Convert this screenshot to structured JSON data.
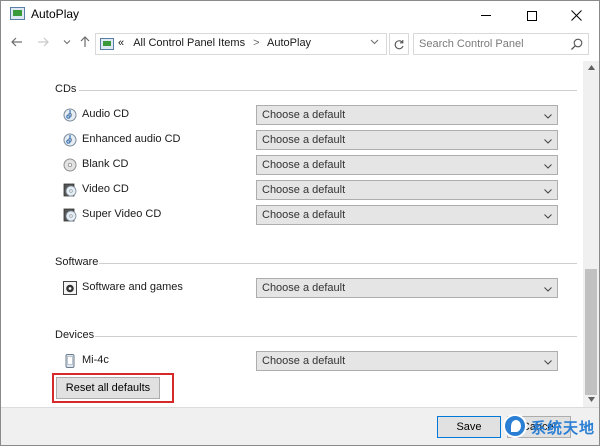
{
  "window": {
    "title": "AutoPlay"
  },
  "titlebar": {
    "minimize_icon": "minimize-icon",
    "maximize_icon": "maximize-icon",
    "close_icon": "close-icon"
  },
  "nav": {
    "back_icon": "back-arrow-icon",
    "forward_icon": "forward-arrow-icon",
    "recent_icon": "chevron-down-icon",
    "up_icon": "up-arrow-icon",
    "overflow": "«",
    "breadcrumbs": [
      "All Control Panel Items",
      "AutoPlay"
    ],
    "refresh_icon": "refresh-icon",
    "search_placeholder": "Search Control Panel"
  },
  "sections": {
    "cds": {
      "title": "CDs",
      "items": [
        {
          "label": "Audio CD",
          "value": "Choose a default",
          "icon": "audio-cd-icon"
        },
        {
          "label": "Enhanced audio CD",
          "value": "Choose a default",
          "icon": "enhanced-audio-cd-icon"
        },
        {
          "label": "Blank CD",
          "value": "Choose a default",
          "icon": "blank-cd-icon"
        },
        {
          "label": "Video CD",
          "value": "Choose a default",
          "icon": "video-cd-icon"
        },
        {
          "label": "Super Video CD",
          "value": "Choose a default",
          "icon": "super-video-cd-icon"
        }
      ]
    },
    "software": {
      "title": "Software",
      "items": [
        {
          "label": "Software and games",
          "value": "Choose a default",
          "icon": "software-icon"
        }
      ]
    },
    "devices": {
      "title": "Devices",
      "items": [
        {
          "label": "Mi-4c",
          "value": "Choose a default",
          "icon": "phone-icon"
        }
      ]
    }
  },
  "reset_button": "Reset all defaults",
  "footer": {
    "save": "Save",
    "cancel": "Cancel"
  },
  "watermark": {
    "text": "系统天地"
  },
  "colors": {
    "highlight": "#d62a2a",
    "accent": "#0078d7",
    "watermark": "#2a7fd4"
  }
}
